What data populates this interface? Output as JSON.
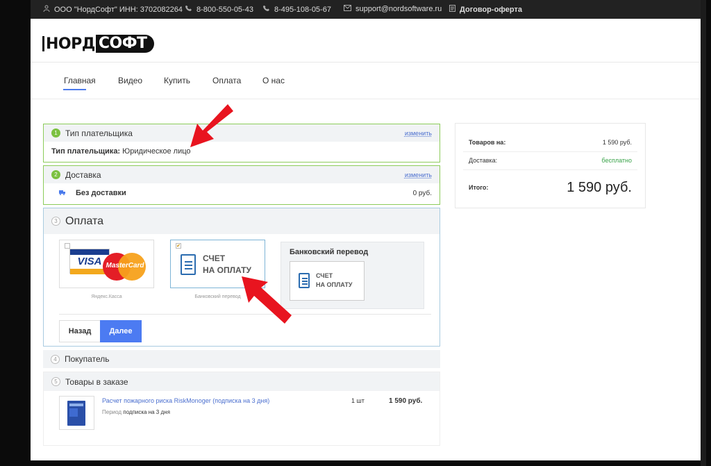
{
  "topbar": {
    "company": "ООО \"НордСофт\" ИНН: 3702082264",
    "phone1": "8-800-550-05-43",
    "phone2": "8-495-108-05-67",
    "email": "support@nordsoftware.ru",
    "offer": "Договор-оферта"
  },
  "logo": {
    "part1": "НОРД",
    "part2": "СОФТ"
  },
  "nav": {
    "items": [
      "Главная",
      "Видео",
      "Купить",
      "Оплата",
      "О нас"
    ]
  },
  "payer": {
    "title": "Тип плательщика",
    "change": "изменить",
    "label": "Тип плательщика:",
    "value": "Юридическое лицо"
  },
  "delivery": {
    "title": "Доставка",
    "change": "изменить",
    "method": "Без доставки",
    "price": "0 руб."
  },
  "payment": {
    "title": "Оплата",
    "step": "3",
    "option1": {
      "visa": "VISA",
      "mastercard": "MasterCard",
      "label": "Яндекс.Касса"
    },
    "option2": {
      "line1": "СЧЕТ",
      "line2": "НА ОПЛАТУ",
      "label": "Банковский перевод",
      "checked": "✔"
    },
    "details": {
      "title": "Банковский перевод",
      "line1": "СЧЕТ",
      "line2": "НА ОПЛАТУ"
    },
    "back": "Назад",
    "next": "Далее"
  },
  "buyer": {
    "step": "4",
    "title": "Покупатель"
  },
  "goods": {
    "step": "5",
    "title": "Товары в заказе",
    "item": {
      "name": "Расчет пожарного риска RiskMonoger (подписка на 3 дня)",
      "period_label": "Период",
      "period_value": "подписка на 3 дня",
      "qty": "1 шт",
      "price": "1 590 руб."
    }
  },
  "summary": {
    "goods_label": "Товаров на:",
    "goods_value": "1 590 руб.",
    "delivery_label": "Доставка:",
    "delivery_value": "бесплатно",
    "total_label": "Итого:",
    "total_value": "1 590 руб."
  },
  "colors": {
    "accent": "#4c7bf2",
    "success": "#7cc141",
    "annotation": "#e8141f"
  },
  "steps": {
    "one": "1",
    "two": "2"
  }
}
